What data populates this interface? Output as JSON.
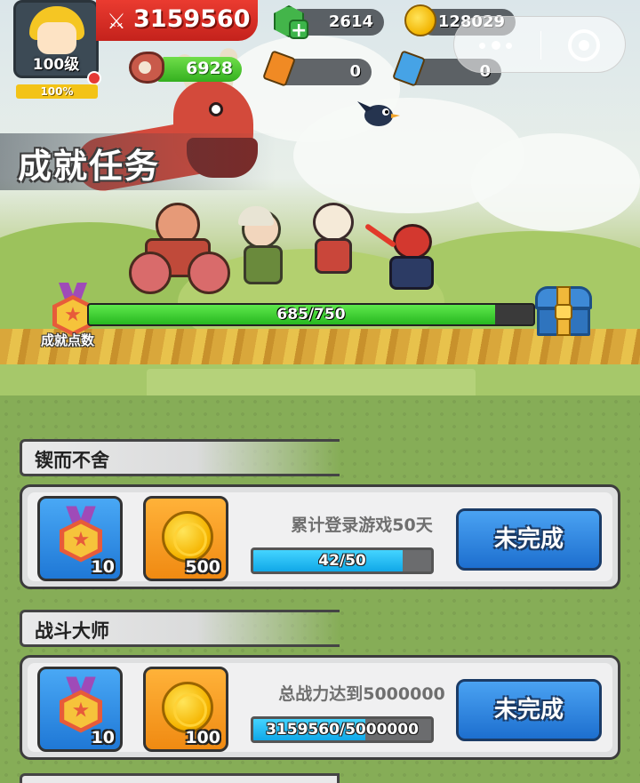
{
  "hud": {
    "level": "100级",
    "exp_percent": "100%",
    "power": "3159560",
    "gems": "2614",
    "coins": "128029",
    "stamina": "6928",
    "ticket_orange": "0",
    "ticket_blue": "0"
  },
  "page": {
    "title": "成就任务"
  },
  "achievement_points": {
    "label": "成就点数",
    "current": 685,
    "total": 750,
    "text": "685/750"
  },
  "tasks": [
    {
      "category": "锲而不舍",
      "medal_reward": "10",
      "coin_reward": "500",
      "description": "累计登录游戏50天",
      "progress_text": "42/50",
      "progress_fraction": 0.84,
      "status": "未完成"
    },
    {
      "category": "战斗大师",
      "medal_reward": "10",
      "coin_reward": "100",
      "description": "总战力达到5000000",
      "progress_text": "3159560/5000000",
      "progress_fraction": 0.632,
      "status": "未完成"
    }
  ],
  "colors": {
    "points_fill": "#27b820",
    "task_fill": "#10a8e8",
    "status_button": "#1d6fcf"
  }
}
